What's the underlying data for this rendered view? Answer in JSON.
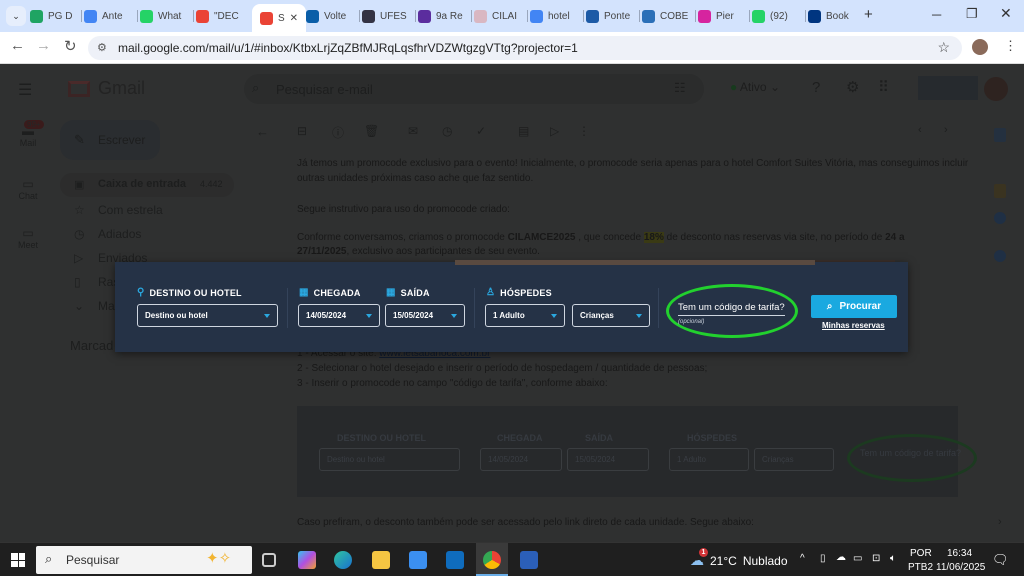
{
  "browser": {
    "tabs": [
      {
        "label": "PG D",
        "color": "#1fa463"
      },
      {
        "label": "Ante",
        "color": "#4285f4"
      },
      {
        "label": "What",
        "color": "#25d366"
      },
      {
        "label": "\"DEC",
        "color": "#ea4335"
      },
      {
        "label": "S",
        "color": "#ea4335",
        "active": true
      },
      {
        "label": "Volte",
        "color": "#0a5ea8"
      },
      {
        "label": "UFES",
        "color": "#334"
      },
      {
        "label": "9a Re",
        "color": "#5b2d9e"
      },
      {
        "label": "CILAI",
        "color": "#d9b7c2"
      },
      {
        "label": "hotel",
        "color": "#4285f4"
      },
      {
        "label": "Ponte",
        "color": "#1c5aa6"
      },
      {
        "label": "COBE",
        "color": "#2a6fb8"
      },
      {
        "label": "Pier",
        "color": "#d6249f"
      },
      {
        "label": "(92)",
        "color": "#25d366"
      },
      {
        "label": "Book",
        "color": "#003580"
      }
    ],
    "new_tab": "+",
    "url": "mail.google.com/mail/u/1/#inbox/KtbxLrjZqZBfMJRqLqsfhrVDZWtgzgVTtg?projector=1"
  },
  "gmail": {
    "logo": "Gmail",
    "search_placeholder": "Pesquisar e-mail",
    "status": "Ativo",
    "compose": "Escrever",
    "rail": [
      {
        "label": "Mail",
        "badge": "99+"
      },
      {
        "label": "Chat"
      },
      {
        "label": "Meet"
      }
    ],
    "nav": [
      {
        "label": "Caixa de entrada",
        "count": "4.442"
      },
      {
        "label": "Com estrela"
      },
      {
        "label": "Adiados"
      },
      {
        "label": "Enviados"
      },
      {
        "label": "Ras"
      },
      {
        "label": "Ma"
      }
    ],
    "labels_heading": "Marcad",
    "body": {
      "p1": "Já temos um promocode exclusivo para o evento! Inicialmente, o promocode seria apenas para o hotel Comfort Suites Vitória, mas conseguimos incluir",
      "p1b": "outras unidades próximas caso ache que faz sentido.",
      "p2": "Segue instrutivo para uso do promocode criado:",
      "p3a": "Conforme conversamos, criamos o promocode ",
      "code": "CILAMCE2025",
      "p3b": " , que concede ",
      "pct": "18%",
      "p3c": " de desconto nas reservas via site, no período de ",
      "period": "24 a",
      "p4a": "27/11/2025",
      "p4b": ", exclusivo aos participantes de seu evento.",
      "step1": "1 - Acessar o site: ",
      "step1_link": "www.letsabarioca.com.br",
      "step2": "2 -  Selecionar o hotel desejado e inserir o período de hospedagem / quantidade de pessoas;",
      "step3": "3 - Inserir o promocode no campo \"código de tarifa\", conforme abaixo:",
      "p5": "Caso prefiram, o desconto também pode ser acessado pelo link direto de cada unidade. Segue abaixo:"
    }
  },
  "booking": {
    "dest_label": "DESTINO OU HOTEL",
    "dest_value": "Destino ou hotel",
    "checkin_label": "CHEGADA",
    "checkin_value": "14/05/2024",
    "checkout_label": "SAÍDA",
    "checkout_value": "15/05/2024",
    "guests_label": "HÓSPEDES",
    "adults_value": "1 Adulto",
    "children_value": "Crianças",
    "rate_code": "Tem um código de tarifa?",
    "optional": "(opcional)",
    "search_button": "Procurar",
    "my_reservations": "Minhas reservas",
    "highlight_color": "#22d12e",
    "accent": "#1aa9e0"
  },
  "taskbar": {
    "search_placeholder": "Pesquisar",
    "weather_temp": "21°C",
    "weather_text": "Nublado",
    "weather_badge": "1",
    "lang1": "POR",
    "lang2": "PTB2",
    "time": "16:34",
    "date": "11/06/2025"
  }
}
